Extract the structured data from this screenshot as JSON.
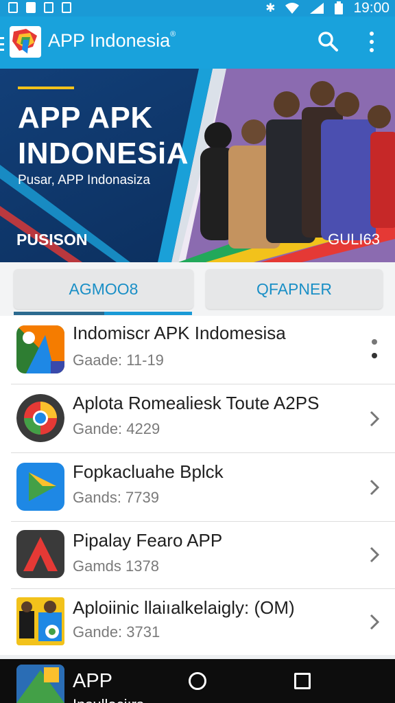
{
  "status_bar": {
    "time": "19:00"
  },
  "app_bar": {
    "title": "APP Indonesia",
    "trademark": "®"
  },
  "banner": {
    "title_line1": "APP APK",
    "title_line2": "INDONESiA",
    "subtitle": "Pusar, APP Indonasiza",
    "tag_left": "PUSISON",
    "tag_right": "GULI63"
  },
  "tabs": [
    {
      "label": "AGMOO8",
      "selected": true
    },
    {
      "label": "QFAPNER",
      "selected": false
    }
  ],
  "apps": [
    {
      "name": "Indomiscr APK Indomesisa",
      "meta": "Gaade: 11-19",
      "icon": "map-icon"
    },
    {
      "name": "Aplota Romealiesk Toute A2PS",
      "meta": "Gande: 4229",
      "icon": "browser-icon"
    },
    {
      "name": "Fopkacluahe Bplck",
      "meta": "Gands: 7739",
      "icon": "play-icon"
    },
    {
      "name": "Pipalay Fearo APP",
      "meta": "Gamds 1378",
      "icon": "letter-a-icon"
    },
    {
      "name": "Aploiinic llaiıalkelaigly: (OM)",
      "meta": "Gande: 3731",
      "icon": "game-icon"
    }
  ],
  "bottom_peek": {
    "title": "APP",
    "subtitle": "Insulleciırs"
  },
  "colors": {
    "primary": "#1a9ad6",
    "banner_bg": "#0f3b73",
    "accent": "#f2c21b"
  }
}
